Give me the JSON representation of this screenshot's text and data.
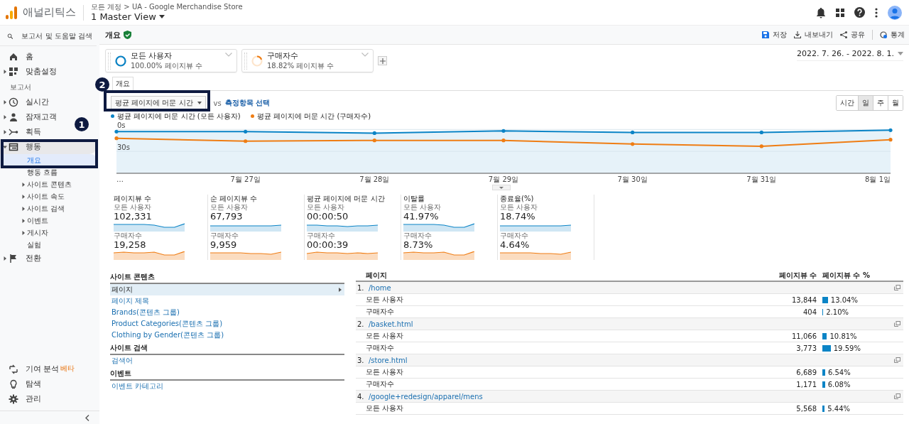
{
  "header": {
    "app_name": "애널리틱스",
    "breadcrumb": "모든 계정 > UA - Google Merchandise Store",
    "view": "1 Master View"
  },
  "sidebar": {
    "search": "보고서 및 도움말 검색",
    "items": [
      {
        "kind": "item",
        "label": "홈"
      },
      {
        "kind": "item",
        "label": "맞춤설정",
        "expanded": false
      },
      {
        "kind": "section",
        "label": "보고서"
      },
      {
        "kind": "item",
        "label": "실시간",
        "expanded": false
      },
      {
        "kind": "item",
        "label": "잠재고객",
        "expanded": false
      },
      {
        "kind": "item",
        "label": "획득",
        "expanded": false
      },
      {
        "kind": "item",
        "label": "행동",
        "expanded": true,
        "selected": true,
        "children": [
          {
            "label": "개요",
            "selected": true
          },
          {
            "label": "행동 흐름",
            "selected": false
          },
          {
            "label": "사이트 콘텐츠",
            "selected": false,
            "expanded": false
          },
          {
            "label": "사이트 속도",
            "selected": false,
            "expanded": false
          },
          {
            "label": "사이트 검색",
            "selected": false,
            "expanded": false
          },
          {
            "label": "이벤트",
            "selected": false,
            "expanded": false
          },
          {
            "label": "게시자",
            "selected": false,
            "expanded": false
          },
          {
            "label": "실험",
            "selected": false
          }
        ]
      },
      {
        "kind": "item",
        "label": "전환",
        "expanded": false
      }
    ],
    "bottom": [
      {
        "label": "기여 분석",
        "badge": "베타"
      },
      {
        "label": "탐색"
      },
      {
        "label": "관리"
      }
    ]
  },
  "toolbar": {
    "title": "개요",
    "actions": [
      "저장",
      "내보내기",
      "공유",
      "통계"
    ]
  },
  "segments": [
    {
      "name": "모든 사용자",
      "detail": "100.00% 페이지뷰 수",
      "color": "#0b84c6"
    },
    {
      "name": "구매자수",
      "detail": "18.82% 페이지뷰 수",
      "color": "#ef7d14"
    }
  ],
  "date_range": "2022. 7. 26. - 2022. 8. 1.",
  "tabs": [
    {
      "label": "개요",
      "selected": true
    }
  ],
  "metric_select": "평균 페이지에 머문 시간",
  "vs": "vs",
  "metric_link": "측정항목 선택",
  "granularity": [
    {
      "label": "시간",
      "selected": false
    },
    {
      "label": "일",
      "selected": true
    },
    {
      "label": "주",
      "selected": false
    },
    {
      "label": "월",
      "selected": false
    }
  ],
  "chart": {
    "legend": [
      {
        "name": "평균 페이지에 머문 시간 (모든 사용자)",
        "color": "#0b84c6"
      },
      {
        "name": "평균 페이지에 머문 시간 (구매자수)",
        "color": "#ef7d14"
      }
    ],
    "y_labels": [
      "0s",
      "30s"
    ],
    "x_labels": [
      "…",
      "7월 27일",
      "7월 28일",
      "7월 29일",
      "7월 30일",
      "7월 31일",
      "8월 1일"
    ]
  },
  "scorecards": [
    {
      "title": "페이지뷰 수",
      "rows": [
        {
          "segment": "모든 사용자",
          "value": "102,331"
        },
        {
          "segment": "구매자수",
          "value": "19,258"
        }
      ]
    },
    {
      "title": "순 페이지뷰 수",
      "rows": [
        {
          "segment": "모든 사용자",
          "value": "67,793"
        },
        {
          "segment": "구매자수",
          "value": "9,959"
        }
      ]
    },
    {
      "title": "평균 페이지에 머문 시간",
      "rows": [
        {
          "segment": "모든 사용자",
          "value": "00:00:50"
        },
        {
          "segment": "구매자수",
          "value": "00:00:39"
        }
      ]
    },
    {
      "title": "이탈률",
      "rows": [
        {
          "segment": "모든 사용자",
          "value": "41.97%"
        },
        {
          "segment": "구매자수",
          "value": "8.73%"
        }
      ]
    },
    {
      "title": "종료율(%)",
      "rows": [
        {
          "segment": "모든 사용자",
          "value": "18.74%"
        },
        {
          "segment": "구매자수",
          "value": "4.64%"
        }
      ]
    }
  ],
  "content_nav": [
    {
      "title": "사이트 콘텐츠",
      "links": [
        {
          "label": "페이지",
          "selected": true
        },
        {
          "label": "페이지 제목",
          "selected": false
        },
        {
          "label": "Brands(콘텐츠 그룹)",
          "selected": false
        },
        {
          "label": "Product Categories(콘텐츠 그룹)",
          "selected": false
        },
        {
          "label": "Clothing by Gender(콘텐츠 그룹)",
          "selected": false
        }
      ]
    },
    {
      "title": "사이트 검색",
      "links": [
        {
          "label": "검색어",
          "selected": false
        }
      ]
    },
    {
      "title": "이벤트",
      "links": [
        {
          "label": "이벤트 카테고리",
          "selected": false
        }
      ]
    }
  ],
  "pages_table": {
    "columns": [
      "페이지",
      "페이지뷰 수",
      "페이지뷰 수 %"
    ],
    "groups": [
      {
        "rank": "1.",
        "page": "/home",
        "rows": [
          {
            "segment": "모든 사용자",
            "views": "13,844",
            "share": "13.04%"
          },
          {
            "segment": "구매자수",
            "views": "404",
            "share": "2.10%"
          }
        ]
      },
      {
        "rank": "2.",
        "page": "/basket.html",
        "rows": [
          {
            "segment": "모든 사용자",
            "views": "11,066",
            "share": "10.81%"
          },
          {
            "segment": "구매자수",
            "views": "3,773",
            "share": "19.59%"
          }
        ]
      },
      {
        "rank": "3.",
        "page": "/store.html",
        "rows": [
          {
            "segment": "모든 사용자",
            "views": "6,689",
            "share": "6.54%"
          },
          {
            "segment": "구매자수",
            "views": "1,171",
            "share": "6.08%"
          }
        ]
      },
      {
        "rank": "4.",
        "page": "/google+redesign/apparel/mens",
        "rows": [
          {
            "segment": "모든 사용자",
            "views": "5,568",
            "share": "5.44%"
          }
        ]
      }
    ]
  },
  "annotations": [
    {
      "label": "1"
    },
    {
      "label": "2"
    }
  ]
}
